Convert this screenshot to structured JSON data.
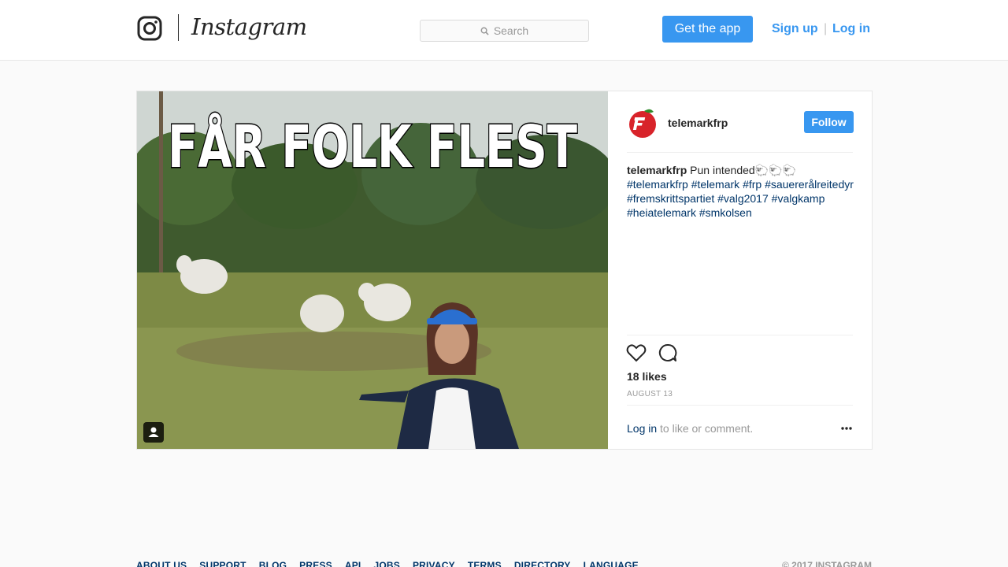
{
  "header": {
    "logo_text": "Instagram",
    "search_placeholder": "Search",
    "get_app_label": "Get the app",
    "signup_label": "Sign up",
    "separator": "|",
    "login_label": "Log in"
  },
  "post": {
    "image_text": "FÅR FOLK FLEST",
    "owner": "telemarkfrp",
    "follow_label": "Follow",
    "caption": {
      "user": "telemarkfrp",
      "text": "Pun intended🐑🐑🐑",
      "tags": [
        "#telemarkfrp",
        "#telemark",
        "#frp",
        "#sauererålreitedyr",
        "#fremskrittspartiet",
        "#valg2017",
        "#valgkamp",
        "#heiatelemark",
        "#smkolsen"
      ]
    },
    "likes": "18 likes",
    "date": "AUGUST 13",
    "login_prompt_link": "Log in",
    "login_prompt_rest": " to like or comment."
  },
  "footer": {
    "links": [
      "ABOUT US",
      "SUPPORT",
      "BLOG",
      "PRESS",
      "API",
      "JOBS",
      "PRIVACY",
      "TERMS",
      "DIRECTORY",
      "LANGUAGE"
    ],
    "copyright": "© 2017 INSTAGRAM"
  },
  "colors": {
    "accent": "#3897f0",
    "link_dark": "#003569",
    "border": "#e6e6e6"
  },
  "icons": [
    "instagram-glyph-icon",
    "search-icon",
    "heart-icon",
    "comment-icon",
    "more-icon",
    "tagged-user-icon"
  ]
}
